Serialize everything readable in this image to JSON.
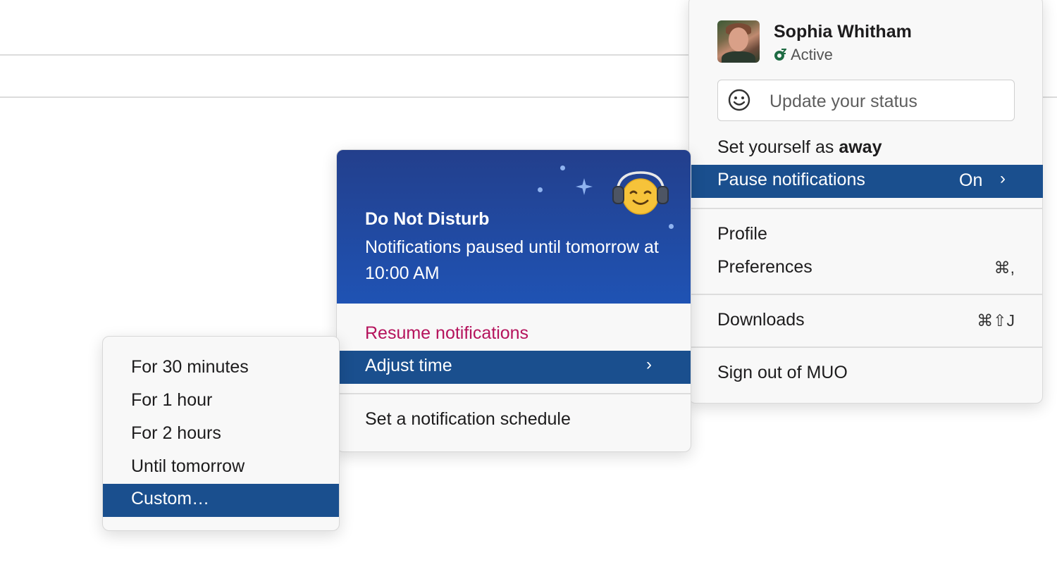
{
  "profile_menu": {
    "user_name": "Sophia Whitham",
    "status": "Active",
    "update_status_placeholder": "Update your status",
    "set_away_prefix": "Set yourself as ",
    "set_away_bold": "away",
    "pause_notifications": {
      "label": "Pause notifications",
      "value": "On",
      "chevron": "›"
    },
    "profile": "Profile",
    "preferences": {
      "label": "Preferences",
      "shortcut": "⌘,"
    },
    "downloads": {
      "label": "Downloads",
      "shortcut": "⌘⇧J"
    },
    "sign_out": "Sign out of MUO"
  },
  "dnd_panel": {
    "title": "Do Not Disturb",
    "description": "Notifications paused until tomorrow at 10:00 AM",
    "resume": "Resume notifications",
    "adjust_time": {
      "label": "Adjust time",
      "chevron": "›"
    },
    "schedule": "Set a notification schedule"
  },
  "time_menu": {
    "items": [
      "For 30 minutes",
      "For 1 hour",
      "For 2 hours",
      "Until tomorrow"
    ],
    "selected": "Custom…"
  },
  "colors": {
    "highlight": "#1a4f8e",
    "banner_top": "#233f8c",
    "banner_bottom": "#1f53b4",
    "resume_text": "#b5135c",
    "active_status": "#1e6b43"
  },
  "icons": [
    "smile-icon",
    "active-status-icon",
    "headphones-emoji-icon",
    "sparkle-icon",
    "chevron-right-icon"
  ]
}
